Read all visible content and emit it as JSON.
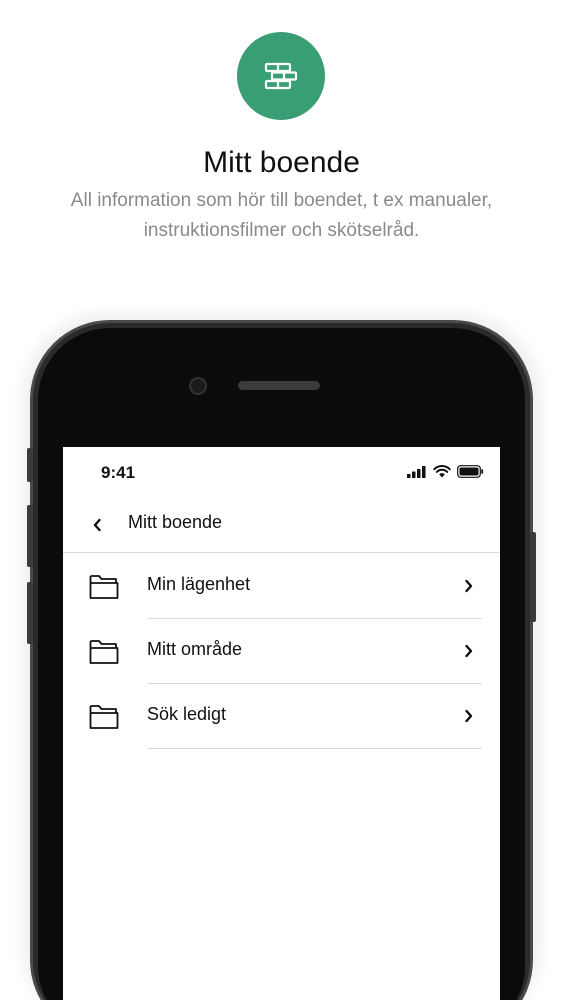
{
  "header": {
    "icon": "app-module-icon",
    "icon_color": "#3a9e74",
    "title": "Mitt boende",
    "subtitle": "All information som hör till boendet, t ex manualer, instruktionsfilmer och skötselråd."
  },
  "phone": {
    "status_time": "9:41",
    "status_icons": [
      "signal-icon",
      "wifi-icon",
      "battery-icon"
    ],
    "nav": {
      "back_icon": "chevron-left-icon",
      "title": "Mitt boende"
    },
    "items": [
      {
        "icon": "folder-icon",
        "label": "Min lägenhet",
        "chevron": "chevron-right-icon"
      },
      {
        "icon": "folder-icon",
        "label": "Mitt område",
        "chevron": "chevron-right-icon"
      },
      {
        "icon": "folder-icon",
        "label": "Sök ledigt",
        "chevron": "chevron-right-icon"
      }
    ]
  }
}
